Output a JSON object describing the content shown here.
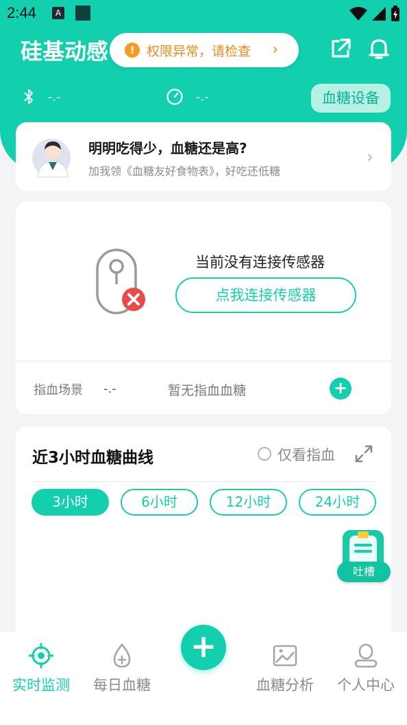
{
  "status_bar": {
    "time": "2:44",
    "notif_a": "A"
  },
  "header": {
    "app_title": "硅基动感",
    "permission_warning": "权限异常，请检查",
    "bluetooth_value": "-.-",
    "timer_value": "-.-",
    "device_button": "血糖设备"
  },
  "promo": {
    "title": "明明吃得少，血糖还是高?",
    "subtitle": "加我领《血糖友好食物表》，好吃还低糖"
  },
  "sensor": {
    "status_text": "当前没有连接传感器",
    "connect_button": "点我连接传感器",
    "finger_label": "指血场景",
    "finger_value": "-.-",
    "finger_none": "暂无指血血糖",
    "add_symbol": "+"
  },
  "curve": {
    "title": "近3小时血糖曲线",
    "finger_only_label": "仅看指血",
    "ranges": [
      "3小时",
      "6小时",
      "12小时",
      "24小时"
    ],
    "active_range": "3小时"
  },
  "feedback": {
    "label": "吐槽"
  },
  "bottom_nav": {
    "items": [
      "实时监测",
      "每日血糖",
      "血糖分析",
      "个人中心"
    ],
    "active": "实时监测",
    "add_symbol": "+"
  },
  "colors": {
    "accent": "#12cfae",
    "warning": "#f08a1c",
    "alert_red": "#e94b4b"
  }
}
